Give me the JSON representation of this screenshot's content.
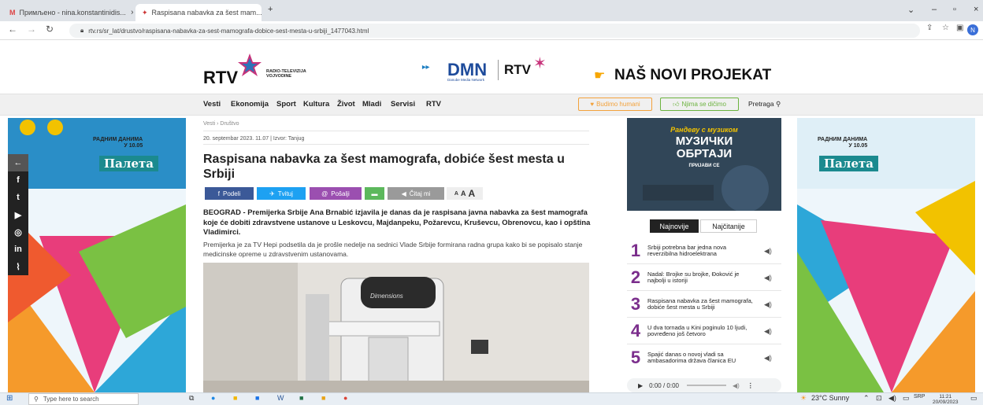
{
  "browser": {
    "tabs": [
      {
        "label": "Примљено - nina.konstantinidis..."
      },
      {
        "label": "Raspisana nabavka za šest mam..."
      }
    ],
    "url": "rtv.rs/sr_lat/drustvo/raspisana-nabavka-za-sest-mamografa-dobice-sest-mesta-u-srbiji_1477043.html",
    "profile": "N"
  },
  "header": {
    "logo": "RTV",
    "logo_sub": "RADIO-TELEVIZIJA VOJVODINE",
    "dmn": "DMN",
    "dmn_sub": "Danube Media Network",
    "dmn_rtv": "RTV",
    "project": "NAŠ NOVI PROJEKAT"
  },
  "menu": {
    "items": [
      "Vesti",
      "Ekonomija",
      "Sport",
      "Kultura",
      "Život",
      "Mladi",
      "Servisi",
      "RTV"
    ],
    "budimo": "Budimo humani",
    "njima": "Njima se dičimo",
    "search": "Pretraga"
  },
  "ads": {
    "radnim": "РАДНИМ ДАНИМА",
    "time": "У 10.05",
    "paleta": "Палета"
  },
  "article": {
    "breadcrumb": "Vesti › Društvo",
    "meta": "20. septembar 2023. 11.07 | Izvor: Tanjug",
    "title": "Raspisana nabavka za šest mamografa, dobiće šest mesta u Srbiji",
    "share": {
      "facebook": "Podeli",
      "twitter": "Tvituj",
      "email": "Pošalji",
      "listen": "Čitaj mi",
      "small": "A",
      "mid": "A",
      "big": "A"
    },
    "lead": "BEOGRAD - Premijerka Srbije Ana Brnabić izjavila je danas da je raspisana javna nabavka za šest mamografa koje će dobiti zdravstvene ustanove u Leskovcu, Majdanpeku, Požarevcu, Kruševcu, Obrenovcu, kao i opština Vladimirci.",
    "body": "Premijerka je za TV Hepi podsetila da je prošle nedelje na sednici Vlade Srbije formirana radna grupa kako bi se popisalo stanje medicinske opreme u zdravstvenim ustanovama.",
    "photo_label": "Dimensions"
  },
  "promo": {
    "top": "Рандеву с музиком",
    "title1": "МУЗИЧКИ",
    "title2": "ОБРТАЈИ",
    "cta": "ПРИЈАВИ СЕ"
  },
  "sidebar": {
    "tabs": [
      "Najnovije",
      "Najčitanije"
    ],
    "items": [
      {
        "n": "1",
        "t": "Srbiji potrebna bar jedna nova reverzibilna hidroelektrana"
      },
      {
        "n": "2",
        "t": "Nadal: Brojke su brojke, Đoković je najbolji u istoriji"
      },
      {
        "n": "3",
        "t": "Raspisana nabavka za šest mamografa, dobiće šest mesta u Srbiji"
      },
      {
        "n": "4",
        "t": "U dva tornada u Kini poginulo 10 ljudi, povređeno još četvoro"
      },
      {
        "n": "5",
        "t": "Spajić danas o novoj vladi sa ambasadorima država članica EU"
      }
    ],
    "audio": "0:00 / 0:00"
  },
  "taskbar": {
    "search": "Type here to search",
    "weather": "23°C  Sunny",
    "lang": "SRP",
    "time": "11:21",
    "date": "20/09/2023"
  }
}
